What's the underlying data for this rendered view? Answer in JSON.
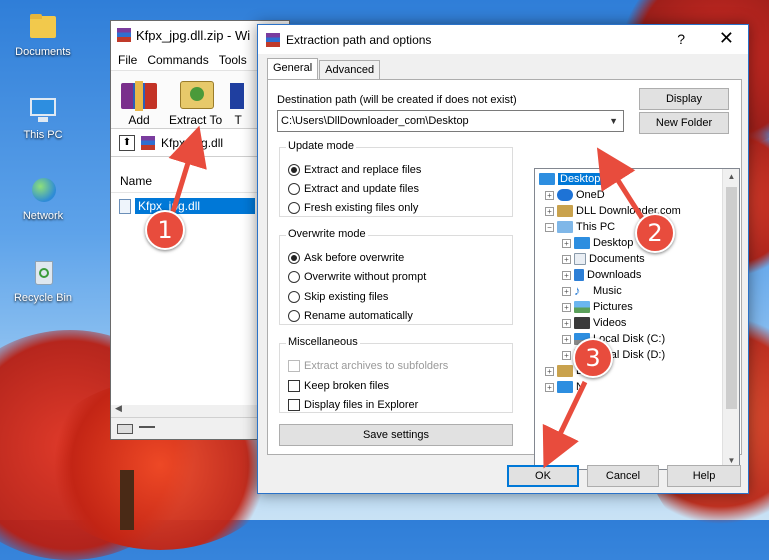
{
  "desktop": {
    "icons": [
      {
        "label": "Documents",
        "icon": "folder-documents-icon"
      },
      {
        "label": "This PC",
        "icon": "monitor-icon"
      },
      {
        "label": "Network",
        "icon": "network-globe-icon"
      },
      {
        "label": "Recycle Bin",
        "icon": "recycle-bin-icon"
      }
    ]
  },
  "winrar": {
    "title": "Kfpx_jpg.dll.zip - Wi",
    "menu": [
      "File",
      "Commands",
      "Tools"
    ],
    "toolbar": {
      "add_label": "Add",
      "extract_label": "Extract To",
      "third_label": "T"
    },
    "path_text": "Kfpx_jpg.dll",
    "column_header": "Name",
    "file_row": "Kfpx_jpg.dll"
  },
  "dialog": {
    "title": "Extraction path and options",
    "help_glyph": "?",
    "close_glyph": "✕",
    "tabs": [
      "General",
      "Advanced"
    ],
    "dest_label": "Destination path (will be created if does not exist)",
    "dest_value": "C:\\Users\\DllDownloader_com\\Desktop",
    "display_button": "Display",
    "new_folder_button": "New Folder",
    "update_mode": {
      "title": "Update mode",
      "options": [
        "Extract and replace files",
        "Extract and update files",
        "Fresh existing files only"
      ],
      "selected": 0
    },
    "overwrite_mode": {
      "title": "Overwrite mode",
      "options": [
        "Ask before overwrite",
        "Overwrite without prompt",
        "Skip existing files",
        "Rename automatically"
      ],
      "selected": 0
    },
    "misc": {
      "title": "Miscellaneous",
      "options": [
        "Extract archives to subfolders",
        "Keep broken files",
        "Display files in Explorer"
      ]
    },
    "save_settings_button": "Save settings",
    "ok_button": "OK",
    "cancel_button": "Cancel",
    "help_button": "Help",
    "tree": [
      {
        "label": "Desktop",
        "selected": true
      },
      {
        "label": "OneD"
      },
      {
        "label": "DLL Downloader.com"
      },
      {
        "label": "This PC"
      },
      {
        "label": "Desktop"
      },
      {
        "label": "Documents"
      },
      {
        "label": "Downloads"
      },
      {
        "label": "Music"
      },
      {
        "label": "Pictures"
      },
      {
        "label": "Videos"
      },
      {
        "label": "Local Disk (C:)"
      },
      {
        "label": "Local Disk (D:)"
      },
      {
        "label": "Lib"
      },
      {
        "label": "N"
      }
    ]
  },
  "markers": [
    "1",
    "2",
    "3"
  ],
  "colors": {
    "marker": "#e84c3d",
    "selection": "#0078d7",
    "foliage": "#d8281c"
  }
}
